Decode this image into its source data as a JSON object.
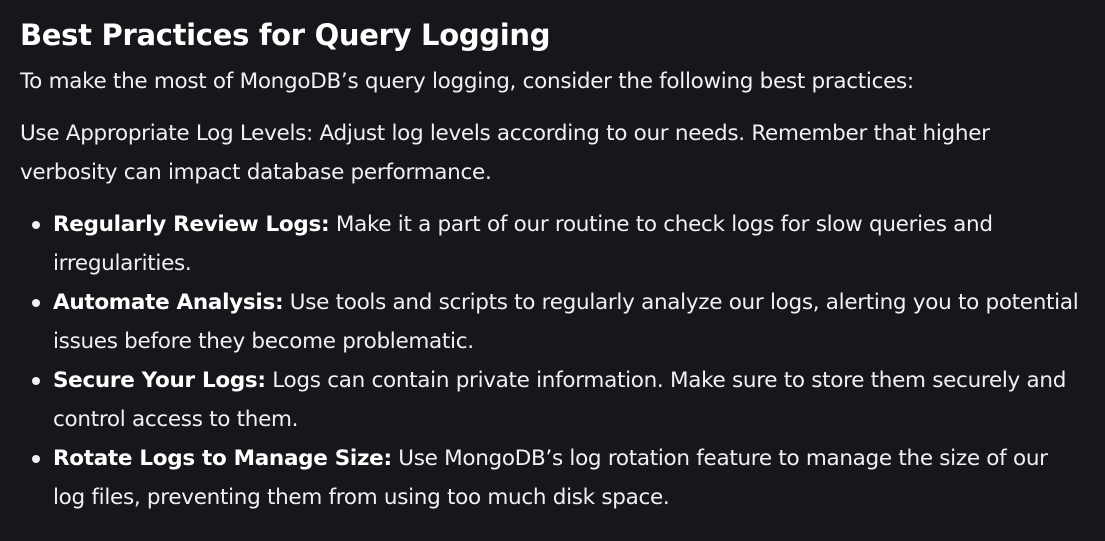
{
  "heading": "Best Practices for Query Logging",
  "intro": "To make the most of MongoDB’s query logging, consider the following best practices:",
  "log_levels": "Use Appropriate Log Levels: Adjust log levels according to our needs. Remember that higher verbosity can impact database performance.",
  "practices": [
    {
      "term": "Regularly Review Logs:",
      "text": " Make it a part of our routine to check logs for slow queries and irregularities."
    },
    {
      "term": "Automate Analysis:",
      "text": " Use tools and scripts to regularly analyze our logs, alerting you to potential issues before they become problematic."
    },
    {
      "term": "Secure Your Logs:",
      "text": " Logs can contain private information. Make sure to store them securely and control access to them."
    },
    {
      "term": "Rotate Logs to Manage Size:",
      "text": " Use MongoDB’s log rotation feature to manage the size of our log files, preventing them from using too much disk space."
    }
  ]
}
